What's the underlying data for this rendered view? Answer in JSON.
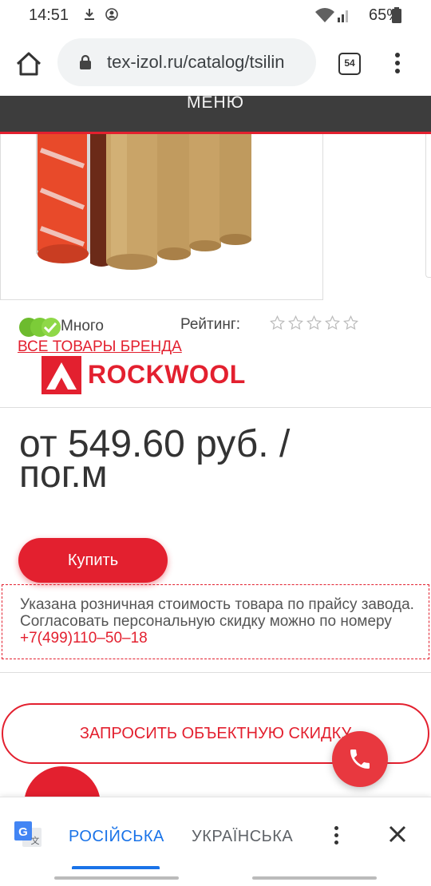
{
  "status_bar": {
    "time": "14:51",
    "battery": "65%"
  },
  "browser": {
    "url": "tex-izol.ru/catalog/tsilin",
    "tab_count": "54"
  },
  "site": {
    "menu_label": "МЕНЮ"
  },
  "product": {
    "availability": "Много",
    "rating_label": "Рейтинг:",
    "rating_value": 0,
    "rating_max": 5,
    "brand_link": "ВСЕ ТОВАРЫ БРЕНДА",
    "brand_name": "ROCKWOOL",
    "price": "от 549.60 руб. / пог.м",
    "buy_label": "Купить",
    "notice_text": "Указана розничная стоимость товара по прайсу завода. Согласовать персональную скидку можно по номеру ",
    "notice_phone": "+7(499)110–50–18",
    "discount_label": "ЗАПРОСИТЬ ОБЪЕКТНУЮ СКИДКУ"
  },
  "translate_bar": {
    "lang_active": "РОСІЙСЬКА",
    "lang_other": "УКРАЇНСЬКА"
  },
  "colors": {
    "accent": "#e3202f",
    "menu_bg": "#3d3d3d",
    "translate_active": "#1a73e8"
  }
}
